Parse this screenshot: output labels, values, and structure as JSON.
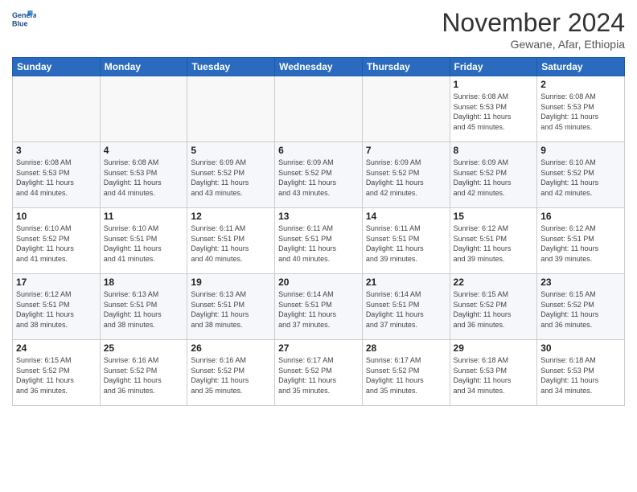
{
  "logo": {
    "line1": "General",
    "line2": "Blue"
  },
  "title": "November 2024",
  "location": "Gewane, Afar, Ethiopia",
  "weekdays": [
    "Sunday",
    "Monday",
    "Tuesday",
    "Wednesday",
    "Thursday",
    "Friday",
    "Saturday"
  ],
  "weeks": [
    [
      {
        "day": "",
        "info": ""
      },
      {
        "day": "",
        "info": ""
      },
      {
        "day": "",
        "info": ""
      },
      {
        "day": "",
        "info": ""
      },
      {
        "day": "",
        "info": ""
      },
      {
        "day": "1",
        "info": "Sunrise: 6:08 AM\nSunset: 5:53 PM\nDaylight: 11 hours\nand 45 minutes."
      },
      {
        "day": "2",
        "info": "Sunrise: 6:08 AM\nSunset: 5:53 PM\nDaylight: 11 hours\nand 45 minutes."
      }
    ],
    [
      {
        "day": "3",
        "info": "Sunrise: 6:08 AM\nSunset: 5:53 PM\nDaylight: 11 hours\nand 44 minutes."
      },
      {
        "day": "4",
        "info": "Sunrise: 6:08 AM\nSunset: 5:53 PM\nDaylight: 11 hours\nand 44 minutes."
      },
      {
        "day": "5",
        "info": "Sunrise: 6:09 AM\nSunset: 5:52 PM\nDaylight: 11 hours\nand 43 minutes."
      },
      {
        "day": "6",
        "info": "Sunrise: 6:09 AM\nSunset: 5:52 PM\nDaylight: 11 hours\nand 43 minutes."
      },
      {
        "day": "7",
        "info": "Sunrise: 6:09 AM\nSunset: 5:52 PM\nDaylight: 11 hours\nand 42 minutes."
      },
      {
        "day": "8",
        "info": "Sunrise: 6:09 AM\nSunset: 5:52 PM\nDaylight: 11 hours\nand 42 minutes."
      },
      {
        "day": "9",
        "info": "Sunrise: 6:10 AM\nSunset: 5:52 PM\nDaylight: 11 hours\nand 42 minutes."
      }
    ],
    [
      {
        "day": "10",
        "info": "Sunrise: 6:10 AM\nSunset: 5:52 PM\nDaylight: 11 hours\nand 41 minutes."
      },
      {
        "day": "11",
        "info": "Sunrise: 6:10 AM\nSunset: 5:51 PM\nDaylight: 11 hours\nand 41 minutes."
      },
      {
        "day": "12",
        "info": "Sunrise: 6:11 AM\nSunset: 5:51 PM\nDaylight: 11 hours\nand 40 minutes."
      },
      {
        "day": "13",
        "info": "Sunrise: 6:11 AM\nSunset: 5:51 PM\nDaylight: 11 hours\nand 40 minutes."
      },
      {
        "day": "14",
        "info": "Sunrise: 6:11 AM\nSunset: 5:51 PM\nDaylight: 11 hours\nand 39 minutes."
      },
      {
        "day": "15",
        "info": "Sunrise: 6:12 AM\nSunset: 5:51 PM\nDaylight: 11 hours\nand 39 minutes."
      },
      {
        "day": "16",
        "info": "Sunrise: 6:12 AM\nSunset: 5:51 PM\nDaylight: 11 hours\nand 39 minutes."
      }
    ],
    [
      {
        "day": "17",
        "info": "Sunrise: 6:12 AM\nSunset: 5:51 PM\nDaylight: 11 hours\nand 38 minutes."
      },
      {
        "day": "18",
        "info": "Sunrise: 6:13 AM\nSunset: 5:51 PM\nDaylight: 11 hours\nand 38 minutes."
      },
      {
        "day": "19",
        "info": "Sunrise: 6:13 AM\nSunset: 5:51 PM\nDaylight: 11 hours\nand 38 minutes."
      },
      {
        "day": "20",
        "info": "Sunrise: 6:14 AM\nSunset: 5:51 PM\nDaylight: 11 hours\nand 37 minutes."
      },
      {
        "day": "21",
        "info": "Sunrise: 6:14 AM\nSunset: 5:51 PM\nDaylight: 11 hours\nand 37 minutes."
      },
      {
        "day": "22",
        "info": "Sunrise: 6:15 AM\nSunset: 5:52 PM\nDaylight: 11 hours\nand 36 minutes."
      },
      {
        "day": "23",
        "info": "Sunrise: 6:15 AM\nSunset: 5:52 PM\nDaylight: 11 hours\nand 36 minutes."
      }
    ],
    [
      {
        "day": "24",
        "info": "Sunrise: 6:15 AM\nSunset: 5:52 PM\nDaylight: 11 hours\nand 36 minutes."
      },
      {
        "day": "25",
        "info": "Sunrise: 6:16 AM\nSunset: 5:52 PM\nDaylight: 11 hours\nand 36 minutes."
      },
      {
        "day": "26",
        "info": "Sunrise: 6:16 AM\nSunset: 5:52 PM\nDaylight: 11 hours\nand 35 minutes."
      },
      {
        "day": "27",
        "info": "Sunrise: 6:17 AM\nSunset: 5:52 PM\nDaylight: 11 hours\nand 35 minutes."
      },
      {
        "day": "28",
        "info": "Sunrise: 6:17 AM\nSunset: 5:52 PM\nDaylight: 11 hours\nand 35 minutes."
      },
      {
        "day": "29",
        "info": "Sunrise: 6:18 AM\nSunset: 5:53 PM\nDaylight: 11 hours\nand 34 minutes."
      },
      {
        "day": "30",
        "info": "Sunrise: 6:18 AM\nSunset: 5:53 PM\nDaylight: 11 hours\nand 34 minutes."
      }
    ]
  ]
}
